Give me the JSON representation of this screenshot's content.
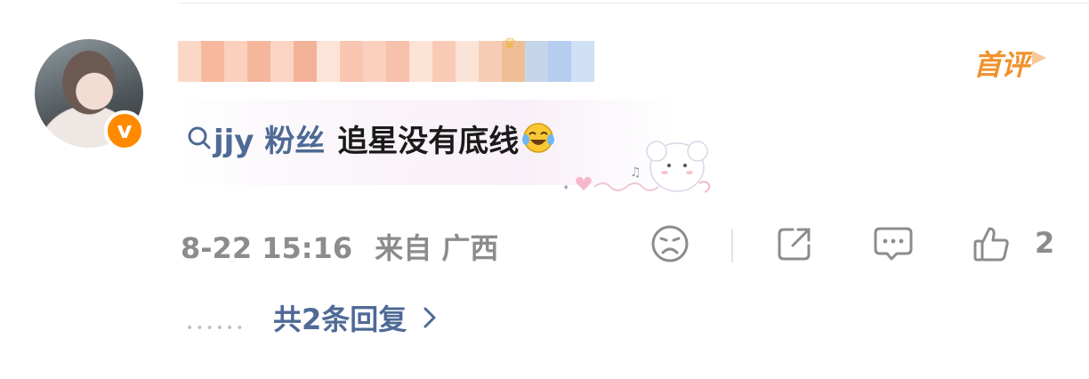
{
  "comment": {
    "topic": "jjy 粉丝",
    "text": "追星没有底线",
    "first_comment_badge": "首评"
  },
  "meta": {
    "time": "8-22 15:16",
    "location": "来自 广西"
  },
  "actions": {
    "like_count": "2"
  },
  "replies": {
    "label": "共2条回复",
    "dots": "••••••"
  },
  "colors": {
    "topic_link": "#4e6a95",
    "badge_orange": "#f0922e",
    "meta_gray": "#8c8c8c",
    "vip_orange": "#ff8a00"
  },
  "icons": [
    "search-icon",
    "laugh-cry-emoji-icon",
    "crown-icon",
    "vip-badge-icon",
    "dislike-emoji-icon",
    "share-icon",
    "comment-icon",
    "thumbs-up-icon",
    "chevron-right-icon"
  ]
}
